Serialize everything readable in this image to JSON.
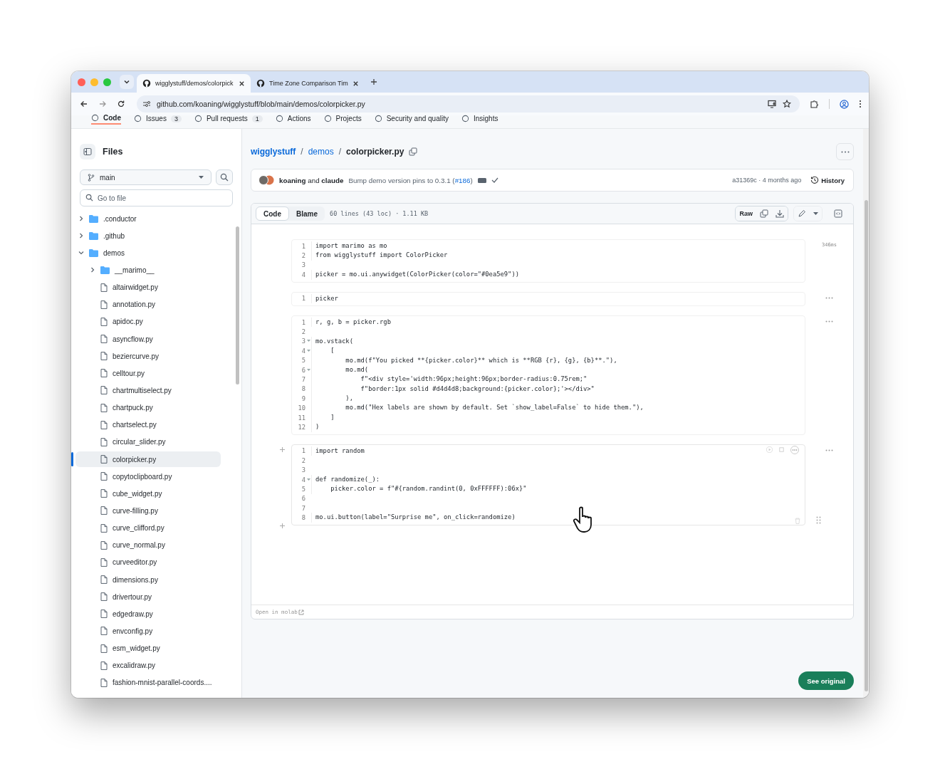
{
  "browser": {
    "tabs": [
      {
        "title": "wigglystuff/demos/colorpick",
        "selected": true
      },
      {
        "title": "Time Zone Comparison Tim",
        "selected": false
      }
    ],
    "url": "github.com/koaning/wigglystuff/blob/main/demos/colorpicker.py"
  },
  "repo_nav": [
    {
      "label": "Code",
      "selected": true
    },
    {
      "label": "Issues",
      "count": "3",
      "selected": false
    },
    {
      "label": "Pull requests",
      "count": "1",
      "selected": false
    },
    {
      "label": "Actions",
      "selected": false
    },
    {
      "label": "Projects",
      "selected": false
    },
    {
      "label": "Security and quality",
      "selected": false
    },
    {
      "label": "Insights",
      "selected": false
    }
  ],
  "sidebar": {
    "title": "Files",
    "branch": "main",
    "search_placeholder": "Go to file",
    "tree": [
      {
        "name": ".conductor",
        "kind": "folder",
        "expanded": false,
        "selected": false
      },
      {
        "name": ".github",
        "kind": "folder",
        "expanded": false,
        "selected": false
      },
      {
        "name": "demos",
        "kind": "folder",
        "expanded": true,
        "selected": false,
        "children": [
          {
            "name": "__marimo__",
            "kind": "folder",
            "expanded": false,
            "selected": false
          },
          {
            "name": "altairwidget.py",
            "kind": "file",
            "selected": false
          },
          {
            "name": "annotation.py",
            "kind": "file",
            "selected": false
          },
          {
            "name": "apidoc.py",
            "kind": "file",
            "selected": false
          },
          {
            "name": "asyncflow.py",
            "kind": "file",
            "selected": false
          },
          {
            "name": "beziercurve.py",
            "kind": "file",
            "selected": false
          },
          {
            "name": "celltour.py",
            "kind": "file",
            "selected": false
          },
          {
            "name": "chartmultiselect.py",
            "kind": "file",
            "selected": false
          },
          {
            "name": "chartpuck.py",
            "kind": "file",
            "selected": false
          },
          {
            "name": "chartselect.py",
            "kind": "file",
            "selected": false
          },
          {
            "name": "circular_slider.py",
            "kind": "file",
            "selected": false
          },
          {
            "name": "colorpicker.py",
            "kind": "file",
            "selected": true
          },
          {
            "name": "copytoclipboard.py",
            "kind": "file",
            "selected": false
          },
          {
            "name": "cube_widget.py",
            "kind": "file",
            "selected": false
          },
          {
            "name": "curve-filling.py",
            "kind": "file",
            "selected": false
          },
          {
            "name": "curve_clifford.py",
            "kind": "file",
            "selected": false
          },
          {
            "name": "curve_normal.py",
            "kind": "file",
            "selected": false
          },
          {
            "name": "curveeditor.py",
            "kind": "file",
            "selected": false
          },
          {
            "name": "dimensions.py",
            "kind": "file",
            "selected": false
          },
          {
            "name": "drivertour.py",
            "kind": "file",
            "selected": false
          },
          {
            "name": "edgedraw.py",
            "kind": "file",
            "selected": false
          },
          {
            "name": "envconfig.py",
            "kind": "file",
            "selected": false
          },
          {
            "name": "esm_widget.py",
            "kind": "file",
            "selected": false
          },
          {
            "name": "excalidraw.py",
            "kind": "file",
            "selected": false
          },
          {
            "name": "fashion-mnist-parallel-coords....",
            "kind": "file",
            "selected": false
          }
        ]
      }
    ]
  },
  "breadcrumb": {
    "separator": "/",
    "items": [
      "wigglystuff",
      "demos",
      "colorpicker.py"
    ]
  },
  "commit": {
    "authors": "**koaning** and **claude**",
    "message": "Bump demo version pins to 0.3.1 (",
    "pr": "#186",
    "message_end": ")",
    "meta": "a31369c · 4 months ago",
    "history": "History"
  },
  "file_view": {
    "tabs": [
      {
        "label": "Code",
        "selected": true
      },
      {
        "label": "Blame",
        "selected": false
      }
    ],
    "info": "60 lines (43 loc) · 1.11 KB",
    "raw": "Raw"
  },
  "notebook": {
    "cells": [
      {
        "active": false,
        "timing": "346ms",
        "lines": [
          {
            "n": "1",
            "code": "import marimo as mo",
            "fold": false
          },
          {
            "n": "2",
            "code": "from wigglystuff import ColorPicker",
            "fold": false
          },
          {
            "n": "3",
            "fold": false
          },
          {
            "n": "4",
            "code": "picker = mo.ui.anywidget(ColorPicker(color=\"#0ea5e9\"))",
            "fold": false
          }
        ]
      },
      {
        "active": false,
        "lines": [
          {
            "n": "1",
            "code": "picker",
            "fold": false
          }
        ]
      },
      {
        "active": false,
        "lines": [
          {
            "n": "1",
            "code": "r, g, b = picker.rgb",
            "fold": false
          },
          {
            "n": "2",
            "fold": false
          },
          {
            "n": "3",
            "code": "mo.vstack(",
            "fold": true
          },
          {
            "n": "4",
            "code": "    [",
            "fold": true
          },
          {
            "n": "5",
            "code": "        mo.md(f\"You picked **{picker.color}** which is **RGB {r}, {g}, {b}**.\"),",
            "fold": false
          },
          {
            "n": "6",
            "code": "        mo.md(",
            "fold": true
          },
          {
            "n": "7",
            "code": "            f\"<div style='width:96px;height:96px;border-radius:0.75rem;\"",
            "fold": false
          },
          {
            "n": "8",
            "code": "            f\"border:1px solid #d4d4d8;background:{picker.color};'></div>\"",
            "fold": false
          },
          {
            "n": "9",
            "code": "        ),",
            "fold": false
          },
          {
            "n": "10",
            "code": "        mo.md(\"Hex labels are shown by default. Set `show_label=False` to hide them.\"),",
            "fold": false
          },
          {
            "n": "11",
            "code": "    ]",
            "fold": false
          },
          {
            "n": "12",
            "code": ")",
            "fold": false
          }
        ]
      },
      {
        "active": true,
        "lines": [
          {
            "n": "1",
            "code": "import random",
            "fold": false
          },
          {
            "n": "2",
            "fold": false
          },
          {
            "n": "3",
            "fold": false
          },
          {
            "n": "4",
            "code": "def randomize(_):",
            "fold": true
          },
          {
            "n": "5",
            "code": "    picker.color = f\"#{random.randint(0, 0xFFFFFF):06x}\"",
            "fold": false
          },
          {
            "n": "6",
            "fold": false
          },
          {
            "n": "7",
            "fold": false
          },
          {
            "n": "8",
            "code": "mo.ui.button(label=\"Surprise me\", on_click=randomize)",
            "fold": false
          }
        ]
      }
    ],
    "footer_link": "Open in molab"
  },
  "see_original": "See original"
}
